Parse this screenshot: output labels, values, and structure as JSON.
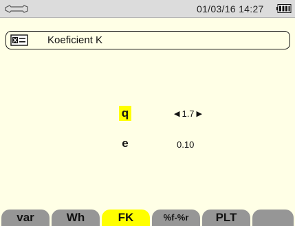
{
  "statusbar": {
    "tools_icon": "wrench-icon",
    "datetime": "01/03/16 14:27",
    "battery_icon": "battery-icon"
  },
  "header": {
    "icon": "settings-list-icon",
    "title": "Koeficient K"
  },
  "params": {
    "q": {
      "label": "q",
      "value": "1.7",
      "selected": true
    },
    "e": {
      "label": "e",
      "value": "0.10"
    }
  },
  "tabs": [
    {
      "label": "var"
    },
    {
      "label": "Wh"
    },
    {
      "label": "FK",
      "active": true
    },
    {
      "label": "%f-%r"
    },
    {
      "label": "PLT"
    },
    {
      "label": ""
    }
  ],
  "colors": {
    "background": "#ffffe6",
    "highlight": "#ffff00",
    "tab": "#969696",
    "statusbar": "#dcdcdc"
  }
}
